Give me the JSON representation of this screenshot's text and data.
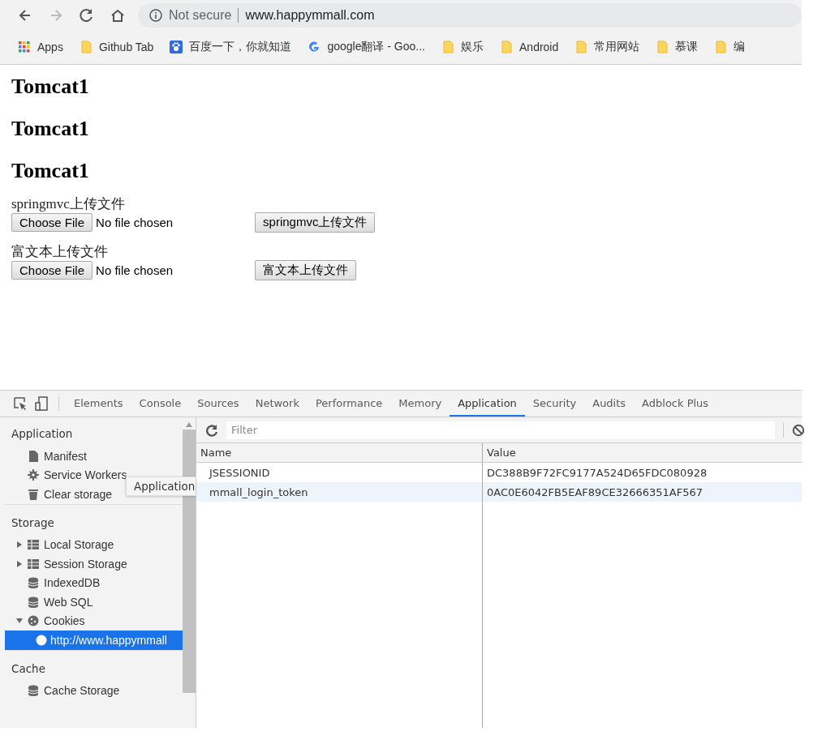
{
  "browser": {
    "security": "Not secure",
    "url": "www.happymmall.com",
    "bookmarks": [
      {
        "label": "Apps",
        "kind": "apps"
      },
      {
        "label": "Github Tab",
        "kind": "folder"
      },
      {
        "label": "百度一下，你就知道",
        "kind": "paw"
      },
      {
        "label": "google翻译 - Goo...",
        "kind": "google"
      },
      {
        "label": "娱乐",
        "kind": "folder"
      },
      {
        "label": "Android",
        "kind": "folder"
      },
      {
        "label": "常用网站",
        "kind": "folder"
      },
      {
        "label": "慕课",
        "kind": "folder"
      },
      {
        "label": "编",
        "kind": "folder"
      }
    ]
  },
  "page": {
    "headings": [
      "Tomcat1",
      "Tomcat1",
      "Tomcat1"
    ],
    "forms": [
      {
        "label": "springmvc上传文件",
        "choose": "Choose File",
        "status": "No file chosen",
        "submit": "springmvc上传文件"
      },
      {
        "label": "富文本上传文件",
        "choose": "Choose File",
        "status": "No file chosen",
        "submit": "富文本上传文件"
      }
    ]
  },
  "devtools": {
    "tabs": [
      {
        "label": "Elements",
        "selected": false
      },
      {
        "label": "Console",
        "selected": false
      },
      {
        "label": "Sources",
        "selected": false
      },
      {
        "label": "Network",
        "selected": false
      },
      {
        "label": "Performance",
        "selected": false
      },
      {
        "label": "Memory",
        "selected": false
      },
      {
        "label": "Application",
        "selected": true
      },
      {
        "label": "Security",
        "selected": false
      },
      {
        "label": "Audits",
        "selected": false
      },
      {
        "label": "Adblock Plus",
        "selected": false
      }
    ],
    "sidebar": [
      {
        "title": "Application",
        "items": [
          {
            "label": "Manifest",
            "kind": "file",
            "selected": false
          },
          {
            "label": "Service Workers",
            "kind": "gear",
            "selected": false
          },
          {
            "label": "Clear storage",
            "kind": "trash",
            "selected": false
          }
        ]
      },
      {
        "title": "Storage",
        "items": [
          {
            "label": "Local Storage",
            "kind": "grid",
            "selected": false,
            "expanded": false
          },
          {
            "label": "Session Storage",
            "kind": "grid",
            "selected": false,
            "expanded": false
          },
          {
            "label": "IndexedDB",
            "kind": "db",
            "selected": false
          },
          {
            "label": "Web SQL",
            "kind": "db",
            "selected": false
          },
          {
            "label": "Cookies",
            "kind": "cookie",
            "selected": false,
            "expanded": true,
            "children": [
              {
                "label": "http://www.happymmall",
                "kind": "cookie",
                "selected": true
              }
            ]
          }
        ]
      },
      {
        "title": "Cache",
        "items": [
          {
            "label": "Cache Storage",
            "kind": "db",
            "selected": false
          }
        ]
      }
    ],
    "tooltip": "Application",
    "filter": {
      "placeholder": "Filter"
    },
    "table": {
      "columns": [
        "Name",
        "Value"
      ],
      "rows": [
        {
          "cells": [
            "JSESSIONID",
            "DC388B9F72FC9177A524D65FDC080928"
          ],
          "selected": false
        },
        {
          "cells": [
            "mmall_login_token",
            "0AC0E6042FB5EAF89CE32666351AF567"
          ],
          "selected": true
        }
      ]
    }
  }
}
